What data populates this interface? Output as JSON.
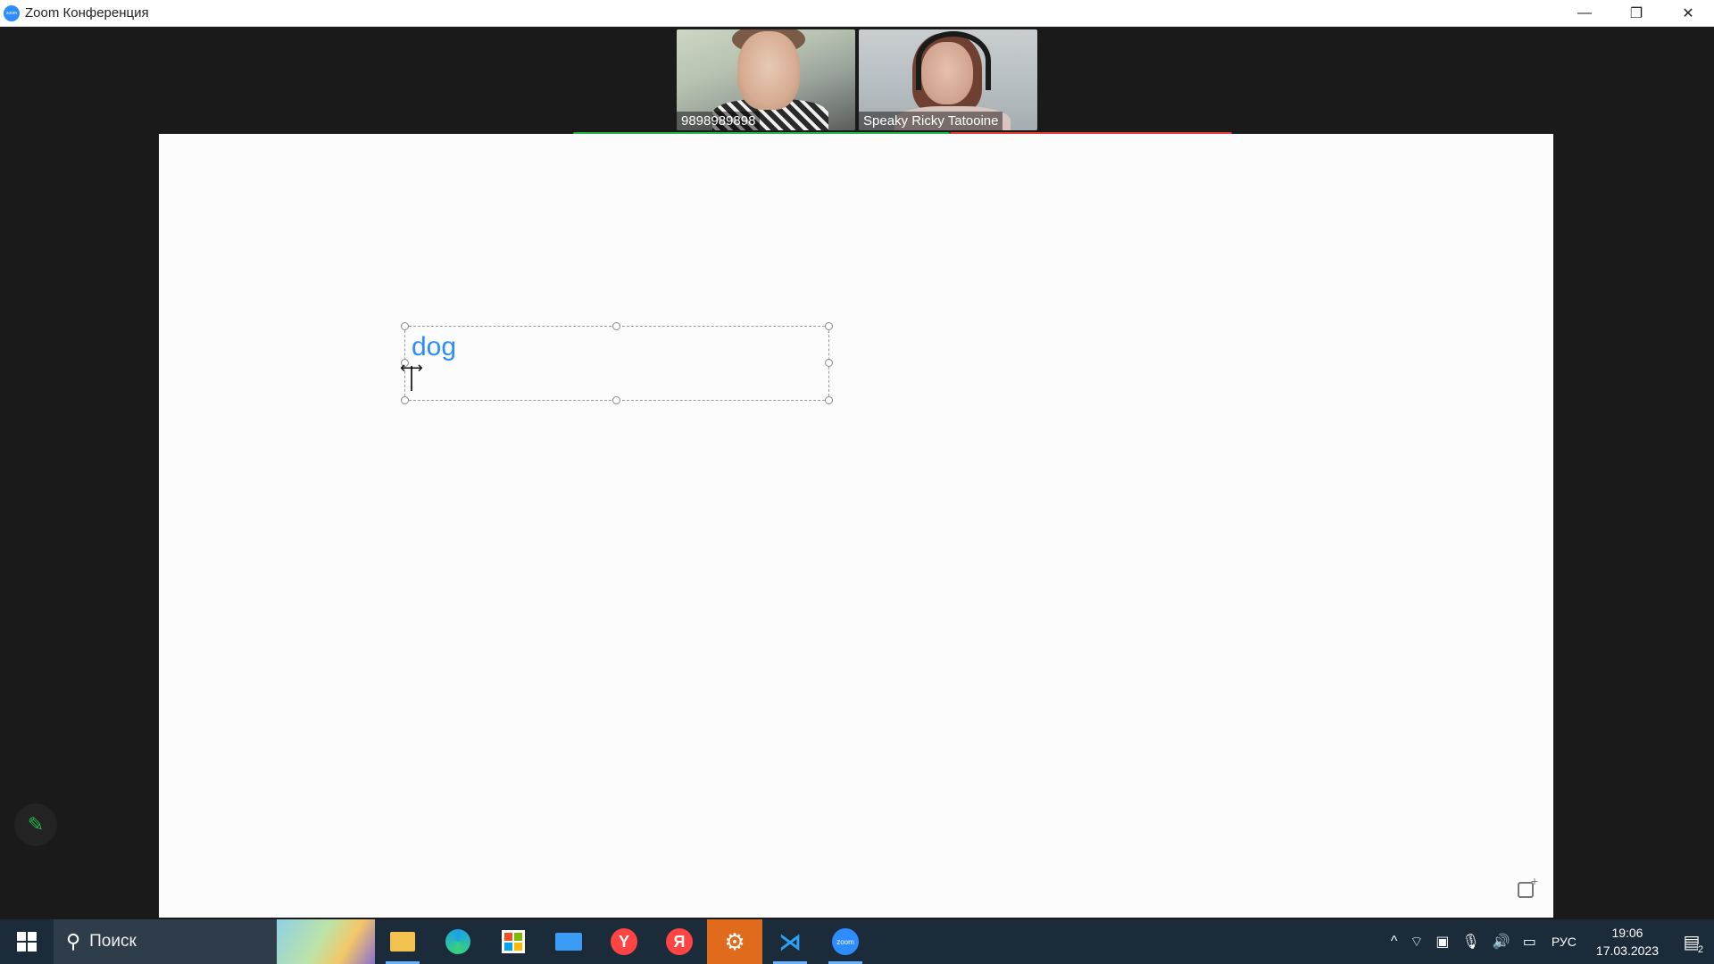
{
  "window": {
    "title": "Zoom Конференция",
    "app_icon": "zoom-logo",
    "controls": {
      "minimize": "—",
      "restore": "❐",
      "close": "✕"
    }
  },
  "participants": [
    {
      "name": "9898989898"
    },
    {
      "name": "Speaky Ricky Tatooine"
    }
  ],
  "whiteboard": {
    "text": "dog",
    "text_color": "#2d8cff"
  },
  "annotate": {
    "icon": "pencil-icon",
    "glyph": "✎"
  },
  "taskbar": {
    "search_placeholder": "Поиск",
    "apps": [
      "file-explorer",
      "edge",
      "microsoft-store",
      "mail",
      "yandex-browser",
      "yandex",
      "settings",
      "vscode",
      "zoom"
    ],
    "settings_glyph": "⚙",
    "vscode_glyph": "⋊",
    "yandex_browser_glyph": "Y",
    "yandex_glyph": "Я",
    "zoom_label": "zoom",
    "tray": {
      "chevron": "^",
      "language": "РУС",
      "time": "19:06",
      "date": "17.03.2023",
      "notifications": "2"
    }
  }
}
